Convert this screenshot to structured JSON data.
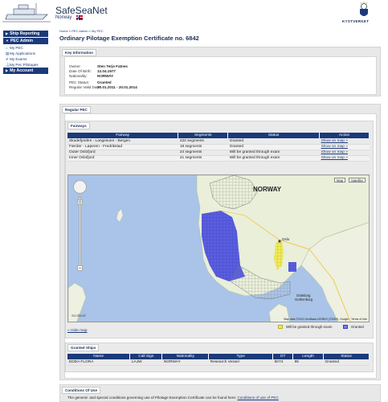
{
  "header": {
    "title": "SafeSeaNet",
    "subtitle": "Norway",
    "agency": "KYSTVERKET"
  },
  "sidebar": {
    "sections": [
      {
        "label": "Ship Reporting"
      },
      {
        "label": "PEC Admin"
      }
    ],
    "items": [
      {
        "label": "My PEC",
        "icon": "home-icon"
      },
      {
        "label": "My Applications",
        "icon": "document-icon"
      },
      {
        "label": "My Exams",
        "icon": "check-icon"
      },
      {
        "label": "My Pec Pilotages",
        "icon": "pilot-icon"
      }
    ],
    "account": "My Account"
  },
  "breadcrumb": "Home » PEC Admin » My PEC",
  "page_title": "Ordinary Pilotage Exemption Certificate no. 6842",
  "key_info": {
    "tab": "Key Information",
    "rows": [
      {
        "key": "Owner:",
        "value": "Sten Terje Fatnes"
      },
      {
        "key": "Date Of Birth:",
        "value": "12.04.1977"
      },
      {
        "key": "Nationality:",
        "value": "NORWAY"
      },
      {
        "key": "PEC Status:",
        "value": "Granted"
      },
      {
        "key": "Regular Valid Date:",
        "value": "20.01.2011 - 20.01.2014"
      }
    ]
  },
  "regular_pec": {
    "tab": "Regular PEC",
    "fairways_tab": "Fairways",
    "columns": [
      "Fairway",
      "Segments",
      "Status",
      "Action"
    ],
    "rows": [
      {
        "fairway": "Skudefjorden - Langesuen - Bergen",
        "segments": "222 segments",
        "status": "Granted",
        "action": "Show on map »"
      },
      {
        "fairway": "Færder - Løperen - Fredrikstad",
        "segments": "18 segments",
        "status": "Granted",
        "action": "Show on map »"
      },
      {
        "fairway": "Outer Oslofjord",
        "segments": "24 segments",
        "status": "Will be granted through exam",
        "action": "Show on map »"
      },
      {
        "fairway": "Inner Oslofjord",
        "segments": "21 segments",
        "status": "Will be granted through exam",
        "action": "Show on map »"
      }
    ],
    "map": {
      "map_button": "Map",
      "satellite_button": "Satellite",
      "country_label": "NORWAY",
      "city_oslo": "Oslo",
      "city_gothenburg": "Göteborg",
      "city_gothenburg_en": "Gothenburg",
      "copyright": "Map data ©2013 GeoBasis-DE/BKG (©2009), Google - Terms of Use",
      "scotland_label": "Scotland"
    },
    "legend": [
      {
        "label": "Will be granted through exam",
        "color": "#f0ea5a"
      },
      {
        "label": "Granted",
        "color": "#7b7fe8"
      }
    ],
    "hide_map": "« Hide map"
  },
  "granted_ships": {
    "tab": "Granted Ships",
    "columns": [
      "Name",
      "Call Sign",
      "Nationality",
      "Type",
      "GT",
      "Length",
      "Status"
    ],
    "rows": [
      {
        "name": "EDDA FLORA",
        "call_sign": "LAJW",
        "nationality": "NORWAY",
        "type": "Research Vessel",
        "gt": "6074",
        "length": "95",
        "status": "Granted"
      }
    ]
  },
  "conditions": {
    "tab": "Conditions Of Use",
    "text": "The general- and special conditions governing use of Pilotage Exemption Certificate can be found here:",
    "link": "Conditions of use of PEC"
  },
  "colors": {
    "navy": "#1b3a7a",
    "granted": "#5a5ee0",
    "exam": "#f0ea5a"
  }
}
